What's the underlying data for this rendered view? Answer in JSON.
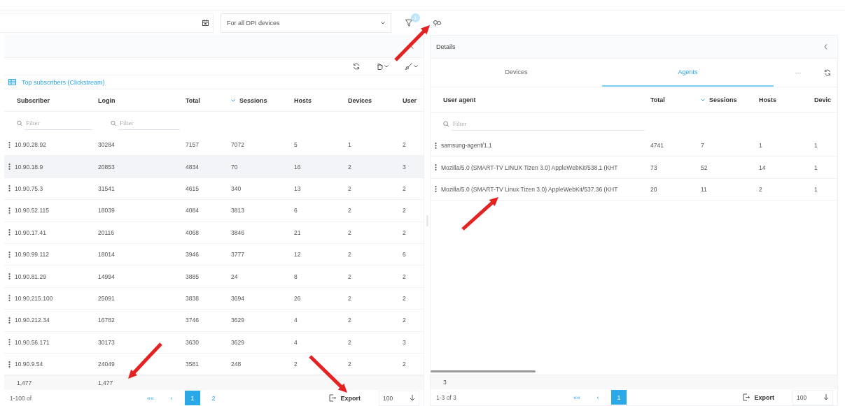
{
  "toolbar": {
    "device_select": {
      "value": "For all DPI devices"
    },
    "filter_badge": "1"
  },
  "subscribers_panel": {
    "title": "Top subscribers (Clickstream)",
    "columns": [
      {
        "label": "Subscriber",
        "sorted": false
      },
      {
        "label": "Login",
        "sorted": false
      },
      {
        "label": "Total",
        "sorted": false
      },
      {
        "label": "Sessions",
        "sorted": true
      },
      {
        "label": "Hosts",
        "sorted": false
      },
      {
        "label": "Devices",
        "sorted": false
      },
      {
        "label": "User",
        "sorted": false
      }
    ],
    "filters": [
      {
        "placeholder": "Filter"
      },
      {
        "placeholder": "Filter"
      }
    ],
    "rows": [
      {
        "cells": [
          "10.90.28.92",
          "30284",
          "7157",
          "7072",
          "5",
          "1",
          "2"
        ],
        "selected": false
      },
      {
        "cells": [
          "10.90.18.9",
          "20853",
          "4834",
          "70",
          "16",
          "2",
          "3"
        ],
        "selected": true
      },
      {
        "cells": [
          "10.90.75.3",
          "31541",
          "4615",
          "340",
          "13",
          "2",
          "2"
        ],
        "selected": false
      },
      {
        "cells": [
          "10.90.52.115",
          "18039",
          "4084",
          "3813",
          "6",
          "2",
          "2"
        ],
        "selected": false
      },
      {
        "cells": [
          "10.90.17.41",
          "20116",
          "4068",
          "3846",
          "21",
          "2",
          "2"
        ],
        "selected": false
      },
      {
        "cells": [
          "10.90.99.112",
          "18014",
          "3946",
          "3777",
          "12",
          "2",
          "6"
        ],
        "selected": false
      },
      {
        "cells": [
          "10.90.81.29",
          "14994",
          "3885",
          "24",
          "8",
          "2",
          "2"
        ],
        "selected": false
      },
      {
        "cells": [
          "10.90.215.100",
          "25091",
          "3838",
          "3694",
          "26",
          "2",
          "2"
        ],
        "selected": false
      },
      {
        "cells": [
          "10.90.212.34",
          "16782",
          "3746",
          "3629",
          "4",
          "2",
          "2"
        ],
        "selected": false
      },
      {
        "cells": [
          "10.90.56.171",
          "30173",
          "3630",
          "3629",
          "4",
          "2",
          "3"
        ],
        "selected": false
      },
      {
        "cells": [
          "10.90.9.54",
          "24049",
          "3581",
          "248",
          "2",
          "2",
          "2"
        ],
        "selected": false
      }
    ],
    "totals": [
      "1,477",
      "1,477"
    ],
    "pagination": {
      "range": "1-100 of",
      "first": "««",
      "previous": "‹",
      "pages": [
        {
          "label": "1",
          "selected": true
        },
        {
          "label": "2",
          "selected": false
        }
      ],
      "export": "Export",
      "page_size": "100"
    }
  },
  "details_panel": {
    "title": "Details",
    "tabs": [
      {
        "label": "Devices",
        "selected": false
      },
      {
        "label": "Agents",
        "selected": true
      }
    ],
    "more": "···",
    "columns": [
      {
        "label": "User agent",
        "sorted": false
      },
      {
        "label": "Total",
        "sorted": false
      },
      {
        "label": "Sessions",
        "sorted": true
      },
      {
        "label": "Hosts",
        "sorted": false
      },
      {
        "label": "Devic",
        "sorted": false
      }
    ],
    "filters": [
      {
        "placeholder": "Filter"
      }
    ],
    "rows": [
      {
        "cells": [
          "samsung-agent/1.1",
          "4741",
          "7",
          "1",
          "1"
        ],
        "selected": false
      },
      {
        "cells": [
          "Mozilla/5.0 (SMART-TV LINUX Tizen 3.0) AppleWebKit/538.1 (KHT",
          "73",
          "52",
          "14",
          "1"
        ],
        "selected": false
      },
      {
        "cells": [
          "Mozilla/5.0 (SMART-TV Linux Tizen 3.0) AppleWebKit/537.36 (KHT",
          "20",
          "11",
          "2",
          "1"
        ],
        "selected": false
      }
    ],
    "totals": [
      "3"
    ],
    "pagination": {
      "range": "1-3 of 3",
      "first": "««",
      "previous": "‹",
      "pages": [
        {
          "label": "1",
          "selected": true
        }
      ],
      "export": "Export",
      "page_size": "100"
    }
  }
}
